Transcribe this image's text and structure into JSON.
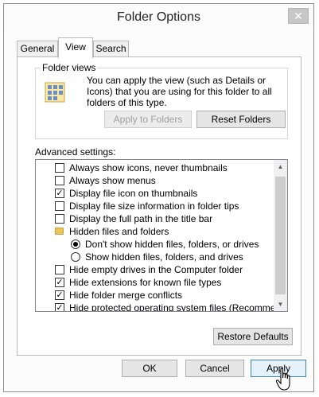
{
  "window": {
    "title": "Folder Options",
    "close_glyph": "✕"
  },
  "tabs": [
    {
      "label": "General",
      "active": false
    },
    {
      "label": "View",
      "active": true
    },
    {
      "label": "Search",
      "active": false
    }
  ],
  "folder_views": {
    "legend": "Folder views",
    "description": "You can apply the view (such as Details or Icons) that you are using for this folder to all folders of this type.",
    "apply_button": "Apply to Folders",
    "reset_button": "Reset Folders"
  },
  "advanced": {
    "label": "Advanced settings:",
    "items": [
      {
        "type": "checkbox",
        "checked": false,
        "label": "Always show icons, never thumbnails"
      },
      {
        "type": "checkbox",
        "checked": false,
        "label": "Always show menus"
      },
      {
        "type": "checkbox",
        "checked": true,
        "label": "Display file icon on thumbnails"
      },
      {
        "type": "checkbox",
        "checked": false,
        "label": "Display file size information in folder tips"
      },
      {
        "type": "checkbox",
        "checked": false,
        "label": "Display the full path in the title bar"
      },
      {
        "type": "folder",
        "label": "Hidden files and folders"
      },
      {
        "type": "radio",
        "checked": true,
        "label": "Don't show hidden files, folders, or drives"
      },
      {
        "type": "radio",
        "checked": false,
        "label": "Show hidden files, folders, and drives"
      },
      {
        "type": "checkbox",
        "checked": false,
        "label": "Hide empty drives in the Computer folder"
      },
      {
        "type": "checkbox",
        "checked": true,
        "label": "Hide extensions for known file types"
      },
      {
        "type": "checkbox",
        "checked": true,
        "label": "Hide folder merge conflicts"
      },
      {
        "type": "checkbox",
        "checked": true,
        "label": "Hide protected operating system files (Recommended)"
      }
    ],
    "restore_button": "Restore Defaults"
  },
  "footer": {
    "ok": "OK",
    "cancel": "Cancel",
    "apply": "Apply"
  },
  "icons": {
    "close": "close-icon",
    "folder_view": "folder-view-icon",
    "scroll_up": "scroll-up-arrow-icon",
    "scroll_down": "scroll-down-arrow-icon",
    "cursor": "hand-pointer-icon"
  },
  "colors": {
    "default_button_border": "#3c7fb1",
    "folder_yellow": "#e8c65a"
  }
}
